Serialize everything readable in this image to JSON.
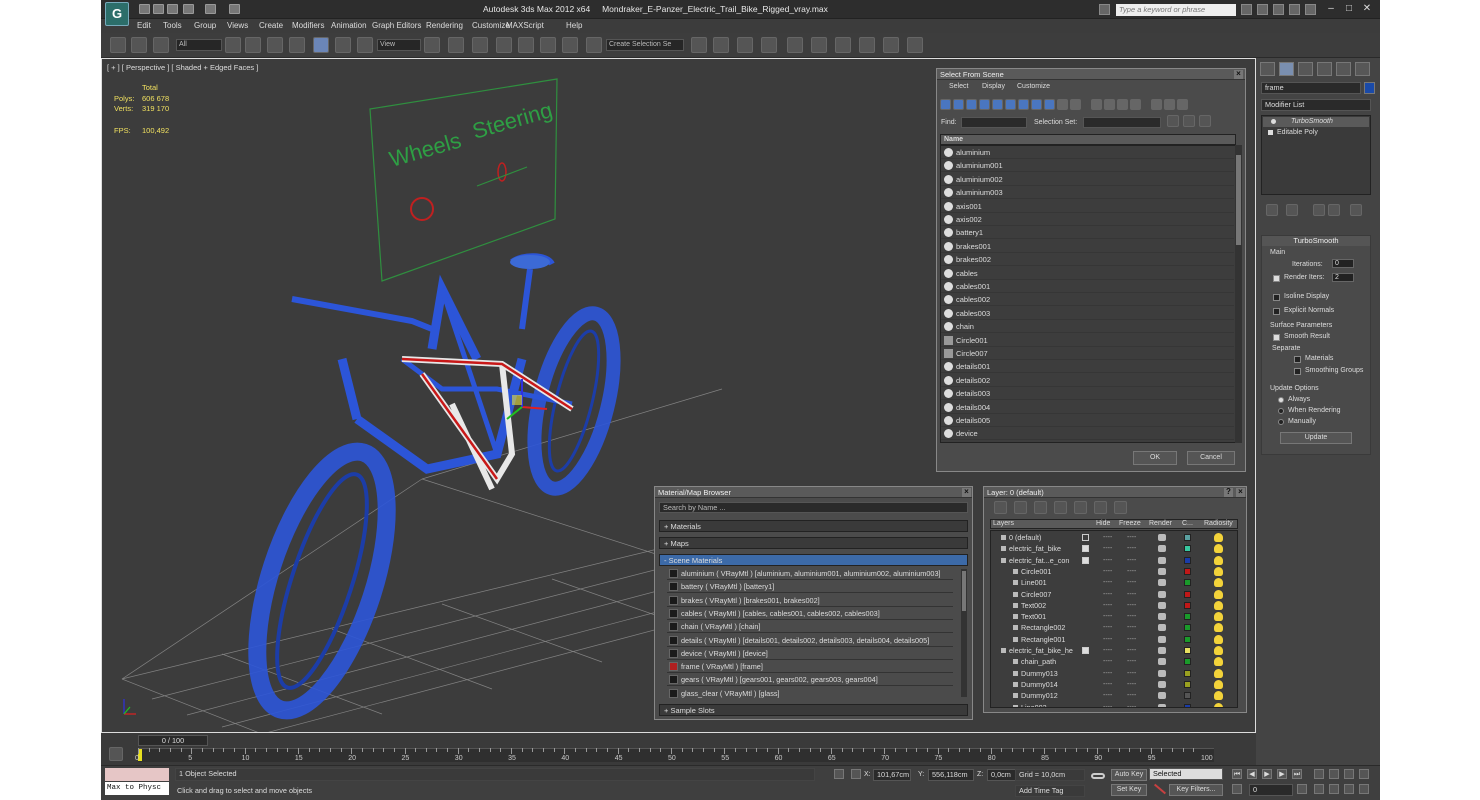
{
  "app": {
    "title": "Autodesk 3ds Max  2012 x64",
    "file": "Mondraker_E-Panzer_Electric_Trail_Bike_Rigged_vray.max",
    "search_placeholder": "Type a keyword or phrase"
  },
  "menu": [
    "Edit",
    "Tools",
    "Group",
    "Views",
    "Create",
    "Modifiers",
    "Animation",
    "Graph Editors",
    "Rendering",
    "Customize",
    "MAXScript",
    "Help"
  ],
  "toolbar": {
    "filter": "All",
    "refcoord": "View",
    "selection_set": "Create Selection Se"
  },
  "viewport": {
    "label": "[ + ] [ Perspective ] [ Shaded + Edged Faces ]",
    "stats": {
      "header": "Total",
      "polys_label": "Polys:",
      "polys": "606 678",
      "verts_label": "Verts:",
      "verts": "319 170",
      "fps_label": "FPS:",
      "fps": "100,492"
    },
    "rig_text": {
      "wheels": "Wheels",
      "steering": "Steering"
    }
  },
  "select_from_scene": {
    "title": "Select From Scene",
    "menu": [
      "Select",
      "Display",
      "Customize"
    ],
    "find_label": "Find:",
    "selection_set_label": "Selection Set:",
    "column_name": "Name",
    "items": [
      "aluminium",
      "aluminium001",
      "aluminium002",
      "aluminium003",
      "axis001",
      "axis002",
      "battery1",
      "brakes001",
      "brakes002",
      "cables",
      "cables001",
      "cables002",
      "cables003",
      "chain",
      "Circle001",
      "Circle007",
      "details001",
      "details002",
      "details003",
      "details004",
      "details005",
      "device"
    ],
    "ok": "OK",
    "cancel": "Cancel"
  },
  "material_browser": {
    "title": "Material/Map Browser",
    "search_placeholder": "Search by Name ...",
    "sections": {
      "materials": "+ Materials",
      "maps": "+ Maps",
      "scene": "- Scene Materials",
      "sample": "+ Sample Slots"
    },
    "scene_materials": [
      {
        "text": "aluminium  ( VRayMtl ) [aluminium, aluminium001, aluminium002, aluminium003]",
        "swatch": "#1a1a1a"
      },
      {
        "text": "battery  ( VRayMtl ) [battery1]",
        "swatch": "#1a1a1a"
      },
      {
        "text": "brakes  ( VRayMtl ) [brakes001, brakes002]",
        "swatch": "#1a1a1a"
      },
      {
        "text": "cables  ( VRayMtl ) [cables, cables001, cables002, cables003]",
        "swatch": "#1a1a1a"
      },
      {
        "text": "chain  ( VRayMtl ) [chain]",
        "swatch": "#1a1a1a"
      },
      {
        "text": "details  ( VRayMtl ) [details001, details002, details003, details004, details005]",
        "swatch": "#1a1a1a"
      },
      {
        "text": "device  ( VRayMtl ) [device]",
        "swatch": "#1a1a1a"
      },
      {
        "text": "frame  ( VRayMtl ) [frame]",
        "swatch": "#b02020"
      },
      {
        "text": "gears  ( VRayMtl ) [gears001, gears002, gears003, gears004]",
        "swatch": "#1a1a1a"
      },
      {
        "text": "glass_clear  ( VRayMtl ) [glass]",
        "swatch": "#1a1a1a"
      }
    ]
  },
  "layer_manager": {
    "title": "Layer: 0 (default)",
    "columns": [
      "Layers",
      "Hide",
      "Freeze",
      "Render",
      "C...",
      "Radiosity"
    ],
    "rows": [
      {
        "name": "0 (default)",
        "indent": 0,
        "color": "#5aa0a0",
        "checked": true
      },
      {
        "name": "electric_fat_bike",
        "indent": 0,
        "color": "#38c8a0"
      },
      {
        "name": "electric_fat...e_con",
        "indent": 0,
        "color": "#1a3ca8"
      },
      {
        "name": "Circle001",
        "indent": 1,
        "color": "#c01818"
      },
      {
        "name": "Line001",
        "indent": 1,
        "color": "#1a9a2a"
      },
      {
        "name": "Circle007",
        "indent": 1,
        "color": "#c01818"
      },
      {
        "name": "Text002",
        "indent": 1,
        "color": "#c01818"
      },
      {
        "name": "Text001",
        "indent": 1,
        "color": "#1a9a2a"
      },
      {
        "name": "Rectangle002",
        "indent": 1,
        "color": "#1a9a2a"
      },
      {
        "name": "Rectangle001",
        "indent": 1,
        "color": "#1a9a2a"
      },
      {
        "name": "electric_fat_bike_he",
        "indent": 0,
        "color": "#e8e060"
      },
      {
        "name": "chain_path",
        "indent": 1,
        "color": "#1a9a2a"
      },
      {
        "name": "Dummy013",
        "indent": 1,
        "color": "#9aa020"
      },
      {
        "name": "Dummy014",
        "indent": 1,
        "color": "#9aa020"
      },
      {
        "name": "Dummy012",
        "indent": 1,
        "color": "#555555"
      },
      {
        "name": "Line002",
        "indent": 1,
        "color": "#1a3ca8"
      }
    ]
  },
  "command_panel": {
    "name_field": "frame",
    "modifier_list": "Modifier List",
    "stack": [
      "TurboSmooth",
      "Editable Poly"
    ],
    "turbosmooth": {
      "title": "TurboSmooth",
      "main": "Main",
      "iterations_label": "Iterations:",
      "iterations": "0",
      "render_iters_label": "Render Iters:",
      "render_iters": "2",
      "isoline": "Isoline Display",
      "explicit": "Explicit Normals",
      "surface_params": "Surface Parameters",
      "smooth_result": "Smooth Result",
      "separate": "Separate",
      "materials": "Materials",
      "smoothing_groups": "Smoothing Groups",
      "update_options": "Update Options",
      "always": "Always",
      "when_rendering": "When Rendering",
      "manually": "Manually",
      "update": "Update"
    }
  },
  "timeline": {
    "slider": "0 / 100",
    "ticks": [
      "0",
      "5",
      "10",
      "15",
      "20",
      "25",
      "30",
      "35",
      "40",
      "45",
      "50",
      "55",
      "60",
      "65",
      "70",
      "75",
      "80",
      "85",
      "90",
      "95",
      "100"
    ]
  },
  "status": {
    "maxscript": "Max to Physc",
    "selected": "1 Object Selected",
    "prompt": "Click and drag to select and move objects",
    "x_label": "X:",
    "x": "101,67cm",
    "y_label": "Y:",
    "y": "556,118cm",
    "z_label": "Z:",
    "z": "0,0cm",
    "grid": "Grid = 10,0cm",
    "add_time_tag": "Add Time Tag",
    "auto_key": "Auto Key",
    "set_key": "Set Key",
    "key_mode": "Selected",
    "key_filters": "Key Filters...",
    "frame": "0"
  }
}
